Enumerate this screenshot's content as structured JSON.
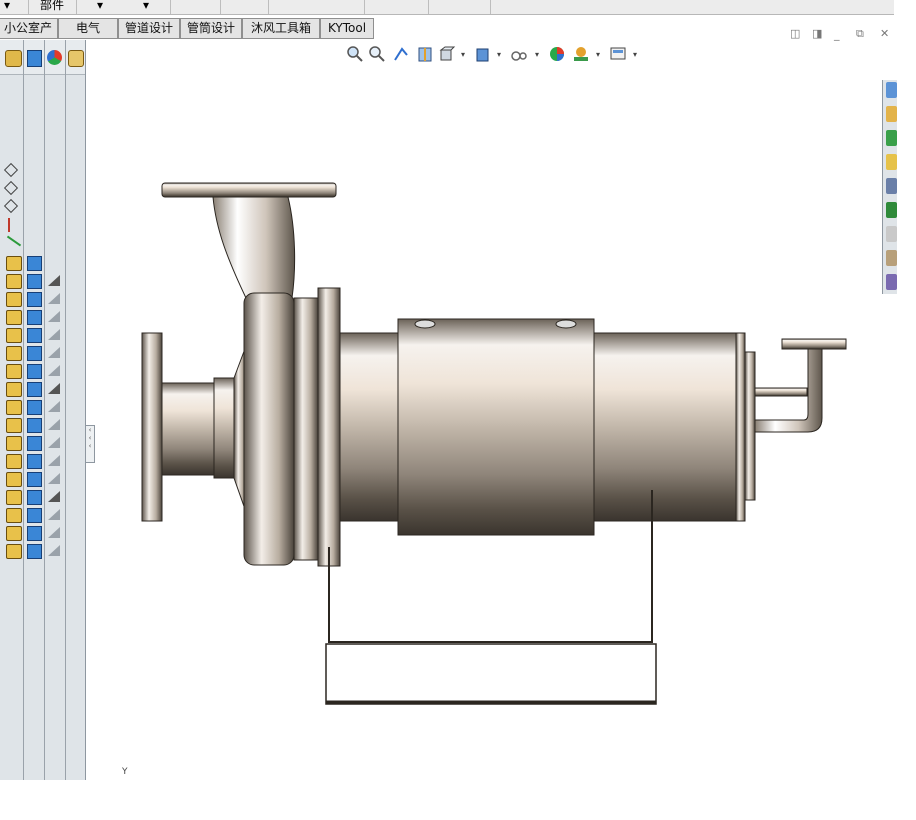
{
  "top_menu": {
    "assembly_label": "部件",
    "dropdown_arrow": "▾"
  },
  "tabs": [
    {
      "label": "小公室产品"
    },
    {
      "label": "电气"
    },
    {
      "label": "管道设计"
    },
    {
      "label": "管筒设计"
    },
    {
      "label": "沐风工具箱"
    },
    {
      "label": "KYTool"
    }
  ],
  "window_controls": [
    "restore-left-icon",
    "restore-right-icon",
    "minimize-icon",
    "maximize-icon",
    "close-icon"
  ],
  "panel_tabs": [
    "featuremanager-icon",
    "propertymanager-icon",
    "configurationmanager-icon",
    "display-manager-icon"
  ],
  "view_toolbar": [
    "zoom-to-fit-icon",
    "zoom-to-area-icon",
    "previous-view-icon",
    "section-view-icon",
    "view-orientation-icon",
    "display-style-icon",
    "hide-show-items-icon",
    "edit-appearance-icon",
    "apply-scene-icon",
    "view-settings-icon"
  ],
  "tree": {
    "planes": [
      "plane-icon",
      "plane-icon",
      "plane-icon"
    ],
    "origin": "origin-icon",
    "mate_row_count": 17
  },
  "right_task_pane": [
    "resources-icon",
    "design-library-icon",
    "file-explorer-icon",
    "view-palette-icon",
    "appearances-icon",
    "custom-properties-icon",
    "document-icon",
    "toolbox-icon",
    "solidworks-forum-icon"
  ],
  "triad_label": "Y",
  "colors": {
    "panel_bg": "#dfe4e8",
    "metal_light": "#f4f0ec",
    "metal_dark": "#3a342e",
    "accent_blue": "#2f6fcf"
  }
}
